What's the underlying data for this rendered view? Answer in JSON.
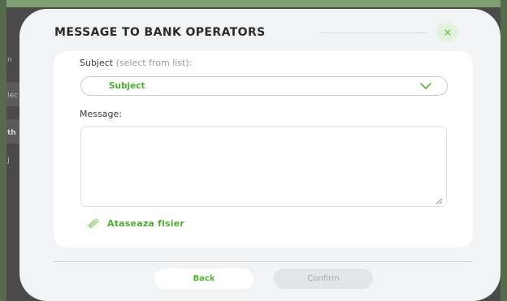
{
  "background": {
    "fragments": [
      "n",
      "lec",
      "th",
      "J"
    ]
  },
  "modal": {
    "title": "MESSAGE TO BANK OPERATORS",
    "close_icon": "close-x-icon",
    "subject": {
      "label": "Subject",
      "hint": "(select from list):",
      "selected_value": "Subject",
      "chevron_icon": "chevron-down-icon"
    },
    "message": {
      "label": "Message:",
      "value": ""
    },
    "attach": {
      "icon": "paperclip-icon",
      "label": "Ataseaza fisier"
    },
    "buttons": {
      "back": "Back",
      "confirm": "Confirm"
    }
  },
  "colors": {
    "accent": "#4cae2f",
    "modal_bg": "#f1f3f4",
    "card_bg": "#ffffff",
    "disabled_bg": "#e3e5e7"
  }
}
